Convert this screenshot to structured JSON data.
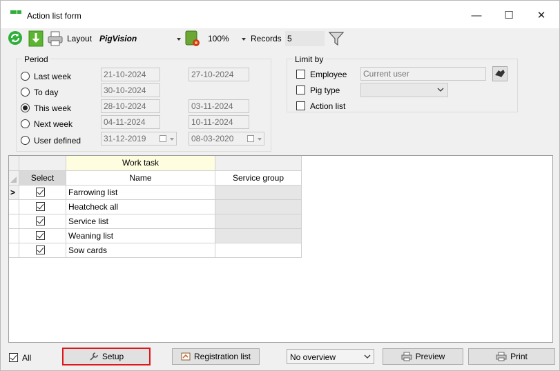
{
  "window": {
    "title": "Action list form",
    "controls": {
      "minimize": "—",
      "maximize": "☐",
      "close": "✕"
    }
  },
  "toolbar": {
    "refresh_icon": "refresh-icon",
    "download_icon": "download-icon",
    "print_icon": "print-icon",
    "layout_label": "Layout",
    "layout_value": "PigVision",
    "layout_settings_icon": "layout-settings-icon",
    "zoom_value": "100%",
    "records_label": "Records",
    "records_value": "5",
    "filter_icon": "filter-icon"
  },
  "period": {
    "title": "Period",
    "options": [
      {
        "label": "Last week",
        "selected": false,
        "from": "21-10-2024",
        "to": "27-10-2024"
      },
      {
        "label": "To day",
        "selected": false,
        "from": "30-10-2024",
        "to": ""
      },
      {
        "label": "This week",
        "selected": true,
        "from": "28-10-2024",
        "to": "03-11-2024"
      },
      {
        "label": "Next week",
        "selected": false,
        "from": "04-11-2024",
        "to": "10-11-2024"
      },
      {
        "label": "User defined",
        "selected": false,
        "from": "31-12-2019",
        "to": "08-03-2020"
      }
    ]
  },
  "limit_by": {
    "title": "Limit by",
    "employee_label": "Employee",
    "employee_placeholder": "Current user",
    "pig_type_label": "Pig type",
    "action_list_label": "Action list",
    "lookup_icon": "lookup-icon"
  },
  "grid": {
    "group_header": "Work task",
    "columns": {
      "select": "Select",
      "name": "Name",
      "service_group": "Service group"
    },
    "current_row_marker": ">",
    "rows": [
      {
        "checked": true,
        "name": "Farrowing list",
        "service_group": ""
      },
      {
        "checked": true,
        "name": "Heatcheck all",
        "service_group": ""
      },
      {
        "checked": true,
        "name": "Service list",
        "service_group": ""
      },
      {
        "checked": true,
        "name": "Weaning list",
        "service_group": ""
      },
      {
        "checked": true,
        "name": "Sow cards",
        "service_group": ""
      }
    ]
  },
  "footer": {
    "all_label": "All",
    "all_checked": true,
    "setup_label": "Setup",
    "registration_label": "Registration list",
    "overview_value": "No overview",
    "preview_label": "Preview",
    "print_label": "Print"
  },
  "colors": {
    "highlight_border": "#e0161a",
    "header_yellow": "#fffde0",
    "accent_green": "#2fae3a"
  }
}
